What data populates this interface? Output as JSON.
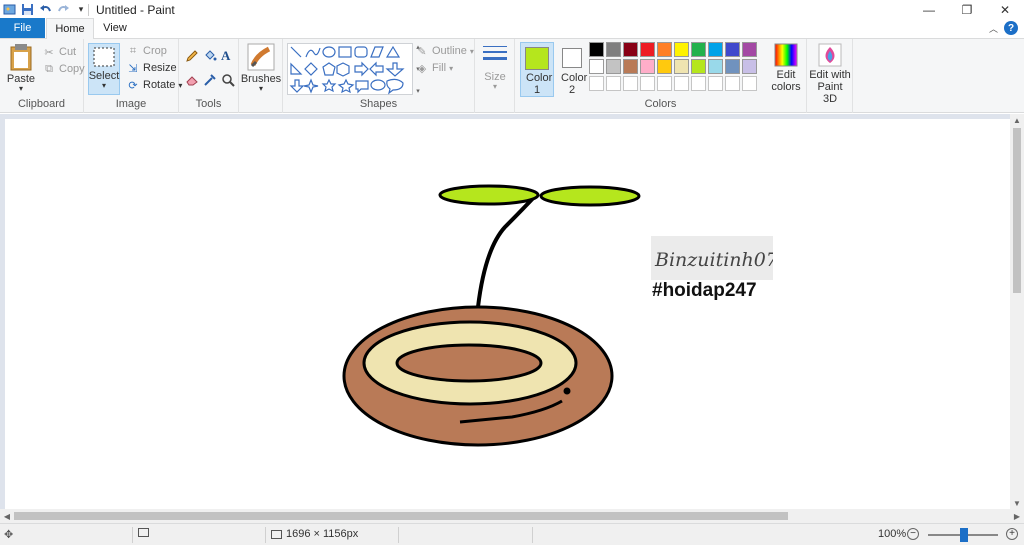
{
  "window": {
    "title": "Untitled - Paint",
    "controls": [
      "minimize-icon",
      "restore-icon",
      "close-icon"
    ]
  },
  "quick_access": [
    "paint-app-icon",
    "save-icon",
    "undo-icon",
    "redo-icon",
    "customize-dropdown-icon"
  ],
  "tabs": [
    {
      "label": "File",
      "active": false
    },
    {
      "label": "Home",
      "active": true
    },
    {
      "label": "View",
      "active": false
    }
  ],
  "ribbon": {
    "clipboard": {
      "group_label": "Clipboard",
      "paste": "Paste",
      "cut": "Cut",
      "copy": "Copy"
    },
    "image": {
      "group_label": "Image",
      "select": "Select",
      "crop": "Crop",
      "resize": "Resize",
      "rotate": "Rotate"
    },
    "tools": {
      "group_label": "Tools"
    },
    "brushes": {
      "label": "Brushes"
    },
    "shapes": {
      "group_label": "Shapes",
      "outline": "Outline",
      "fill": "Fill"
    },
    "size": {
      "label": "Size"
    },
    "colors": {
      "group_label": "Colors",
      "color1_label": "Color 1",
      "color2_label": "Color 2",
      "color1_value": "#b5e61d",
      "color2_value": "#ffffff",
      "palette_row1": [
        "#000000",
        "#7f7f7f",
        "#880015",
        "#ed1c24",
        "#ff7f27",
        "#fff200",
        "#22b14c",
        "#00a2e8",
        "#3f48cc",
        "#a349a4"
      ],
      "palette_row2": [
        "#ffffff",
        "#c3c3c3",
        "#b97a57",
        "#ffaec9",
        "#ffc90e",
        "#efe4b0",
        "#b5e61d",
        "#99d9ea",
        "#7092be",
        "#c8bfe7"
      ],
      "edit_colors": "Edit colors",
      "edit_paint3d": "Edit with Paint 3D"
    }
  },
  "canvas": {
    "watermark_signature": "Binzuitinh07",
    "hashtag": "#hoidap247",
    "drawing_colors": {
      "leaf": "#b5e61d",
      "pot": "#b97a57",
      "pot_ring": "#efe4b0",
      "outline": "#000000"
    }
  },
  "status": {
    "canvas_size": "1696 × 1156px",
    "zoom": "100%"
  }
}
